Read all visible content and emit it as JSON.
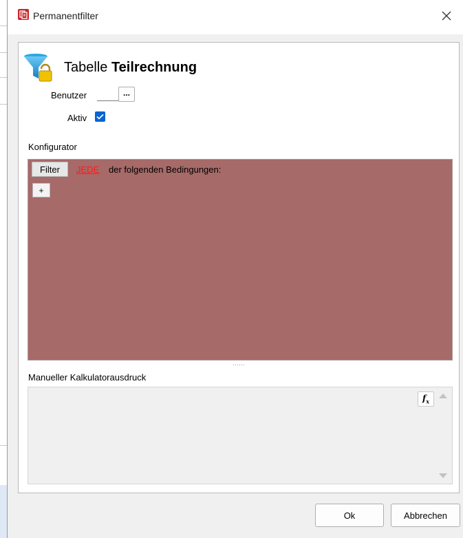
{
  "window": {
    "title": "Permanentfilter",
    "icon": "app-icon",
    "close_icon": "close-icon"
  },
  "header": {
    "icon": "filter-lock-icon",
    "prefix": "Tabelle",
    "table_name": "Teilrechnung"
  },
  "form": {
    "benutzer_label": "Benutzer",
    "benutzer_value": "",
    "benutzer_button": "...",
    "aktiv_label": "Aktiv",
    "aktiv_checked": true
  },
  "konfigurator": {
    "label": "Konfigurator",
    "filter_button": "Filter",
    "mode_link": "JEDE",
    "condition_text": "der folgenden Bedingungen:",
    "add_button": "+",
    "background_color": "#a66a69"
  },
  "calculator": {
    "label": "Manueller Kalkulatorausdruck",
    "expression": "",
    "fx_button": "fx"
  },
  "footer": {
    "ok_button": "Ok",
    "cancel_button": "Abbrechen"
  },
  "colors": {
    "link_red": "#ff1a1a",
    "checkbox_blue": "#0a64d0",
    "funnel_blue": "#1a9fe0",
    "lock_yellow": "#f2c200"
  }
}
